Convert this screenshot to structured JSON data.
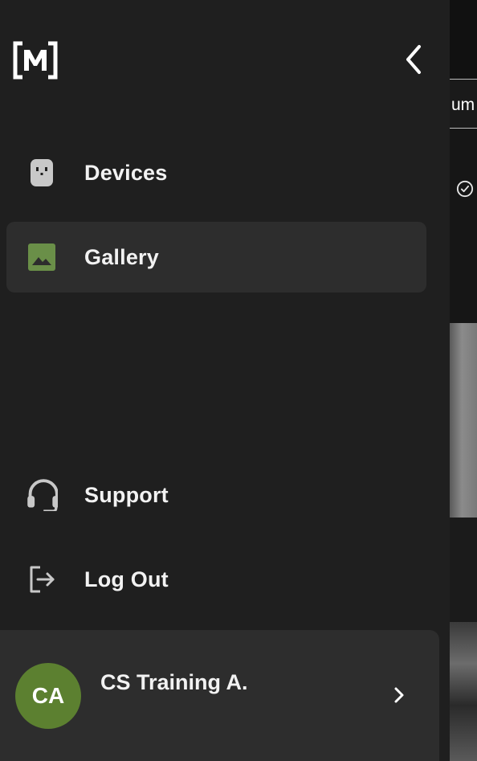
{
  "drawer": {
    "logo_text": "M",
    "collapse_icon": "chevron-left-icon"
  },
  "nav": {
    "items": [
      {
        "label": "Devices",
        "icon": "device-icon",
        "active": false
      },
      {
        "label": "Gallery",
        "icon": "image-icon",
        "active": true
      }
    ],
    "footer_items": [
      {
        "label": "Support",
        "icon": "headset-icon"
      },
      {
        "label": "Log Out",
        "icon": "logout-icon"
      }
    ]
  },
  "user": {
    "initials": "CA",
    "name": "CS Training A.",
    "avatar_color": "#5c8030",
    "chevron_icon": "chevron-right-icon"
  },
  "background": {
    "tab_partial_text": "um"
  },
  "colors": {
    "drawer_bg": "#1f1f1f",
    "active_item_bg": "#2d2d2d",
    "gallery_icon": "#6a8f48",
    "icon_gray": "#c8c8c8",
    "text": "#f2f2f2"
  }
}
